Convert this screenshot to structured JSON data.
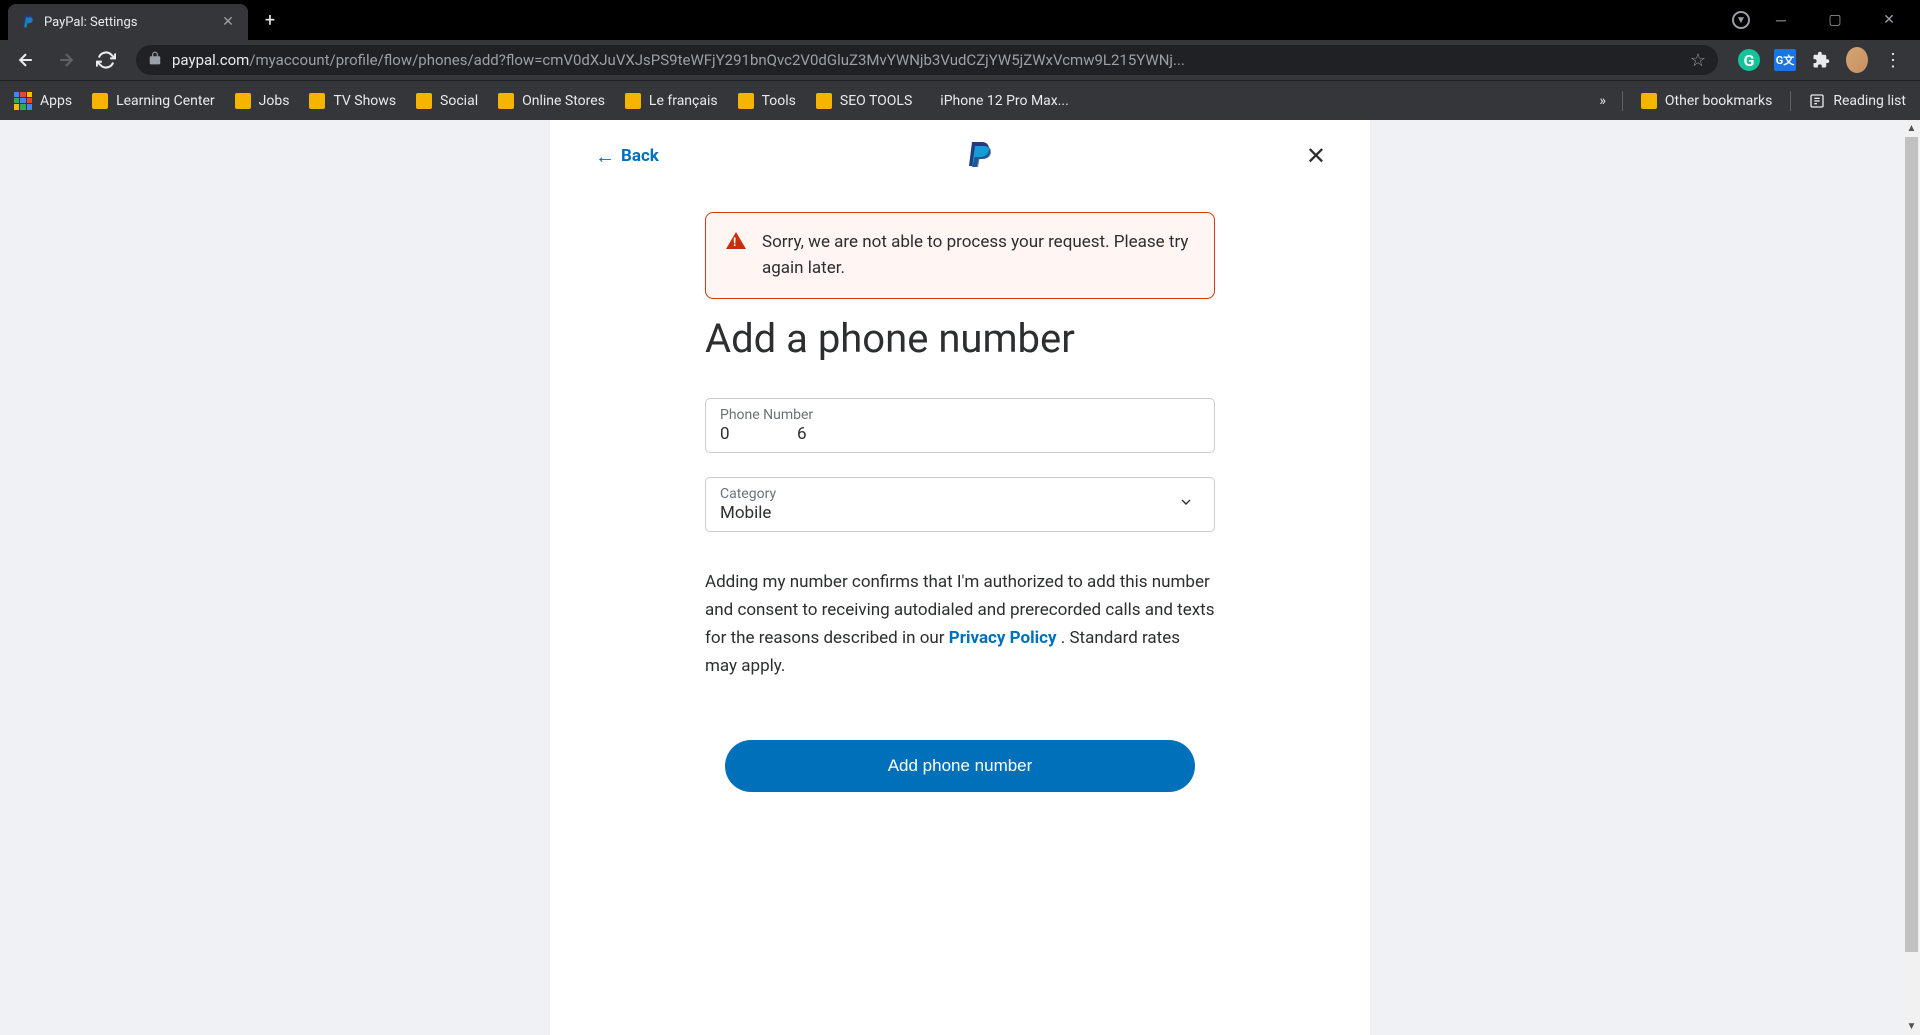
{
  "browser": {
    "tab_title": "PayPal: Settings",
    "url_domain": "paypal.com",
    "url_path": "/myaccount/profile/flow/phones/add?flow=cmV0dXJuVXJsPS9teWFjY291bnQvc2V0dGluZ3MvYWNjb3VudCZjYW5jZWxVcmw9L215YWNj..."
  },
  "bookmarks": {
    "apps": "Apps",
    "items": [
      "Learning Center",
      "Jobs",
      "TV Shows",
      "Social",
      "Online Stores",
      "Le français",
      "Tools",
      "SEO TOOLS"
    ],
    "apple_item": "iPhone 12 Pro Max...",
    "other": "Other bookmarks",
    "reading_list": "Reading list"
  },
  "modal": {
    "back_label": "Back",
    "error_message": "Sorry, we are not able to process your request. Please try again later.",
    "heading": "Add a phone number",
    "phone_label": "Phone Number",
    "phone_value": "0                6",
    "category_label": "Category",
    "category_value": "Mobile",
    "consent_text_part1": "Adding my number confirms that I'm authorized to add this number and consent to receiving autodialed and prerecorded calls and texts for the reasons described in our ",
    "privacy_link": "Privacy Policy",
    "consent_text_part2": " . Standard rates may apply.",
    "submit_label": "Add phone number"
  }
}
